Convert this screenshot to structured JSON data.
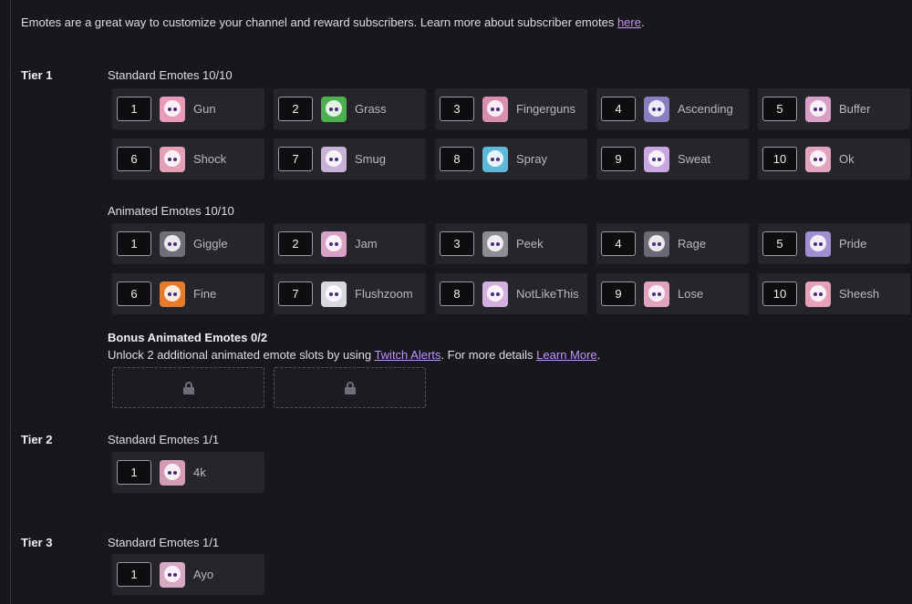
{
  "intro": {
    "text": "Emotes are a great way to customize your channel and reward subscribers. Learn more about subscriber emotes ",
    "link": "here",
    "end": "."
  },
  "tier1": {
    "label": "Tier 1",
    "standard": {
      "title": "Standard Emotes 10/10",
      "emotes": [
        {
          "slot": "1",
          "name": "Gun",
          "color": "#e89ab8"
        },
        {
          "slot": "2",
          "name": "Grass",
          "color": "#4caf50"
        },
        {
          "slot": "3",
          "name": "Fingerguns",
          "color": "#d98fb0"
        },
        {
          "slot": "4",
          "name": "Ascending",
          "color": "#8a7fbf"
        },
        {
          "slot": "5",
          "name": "Buffer",
          "color": "#d8a0c8"
        },
        {
          "slot": "6",
          "name": "Shock",
          "color": "#e4a0b6"
        },
        {
          "slot": "7",
          "name": "Smug",
          "color": "#c8b2d6"
        },
        {
          "slot": "8",
          "name": "Spray",
          "color": "#5fb8d8"
        },
        {
          "slot": "9",
          "name": "Sweat",
          "color": "#c9a7e2"
        },
        {
          "slot": "10",
          "name": "Ok",
          "color": "#e3a5bd"
        }
      ]
    },
    "animated": {
      "title": "Animated Emotes 10/10",
      "emotes": [
        {
          "slot": "1",
          "name": "Giggle",
          "color": "#6f6f7a"
        },
        {
          "slot": "2",
          "name": "Jam",
          "color": "#d7a2c6"
        },
        {
          "slot": "3",
          "name": "Peek",
          "color": "#8d8d96"
        },
        {
          "slot": "4",
          "name": "Rage",
          "color": "#6a6a76"
        },
        {
          "slot": "5",
          "name": "Pride",
          "color": "#a08fd0"
        },
        {
          "slot": "6",
          "name": "Fine",
          "color": "#e67a2a"
        },
        {
          "slot": "7",
          "name": "Flushzoom",
          "color": "#d8d8e0"
        },
        {
          "slot": "8",
          "name": "NotLikeThis",
          "color": "#d4b0e0"
        },
        {
          "slot": "9",
          "name": "Lose",
          "color": "#e0a4c0"
        },
        {
          "slot": "10",
          "name": "Sheesh",
          "color": "#e6a0b8"
        }
      ]
    },
    "bonus": {
      "title": "Bonus Animated Emotes 0/2",
      "desc_start": "Unlock 2 additional animated emote slots by using ",
      "link1": "Twitch Alerts",
      "desc_mid": ". For more details ",
      "link2": "Learn More",
      "desc_end": ".",
      "lock_icon": "lock-icon"
    }
  },
  "tier2": {
    "label": "Tier 2",
    "standard": {
      "title": "Standard Emotes 1/1",
      "emotes": [
        {
          "slot": "1",
          "name": "4k",
          "color": "#d59bb5"
        }
      ]
    }
  },
  "tier3": {
    "label": "Tier 3",
    "standard": {
      "title": "Standard Emotes 1/1",
      "emotes": [
        {
          "slot": "1",
          "name": "Ayo",
          "color": "#d8a8c4"
        }
      ]
    }
  },
  "colors": {
    "link": "#bf94ff",
    "card": "#26252c",
    "background": "#18171c"
  }
}
